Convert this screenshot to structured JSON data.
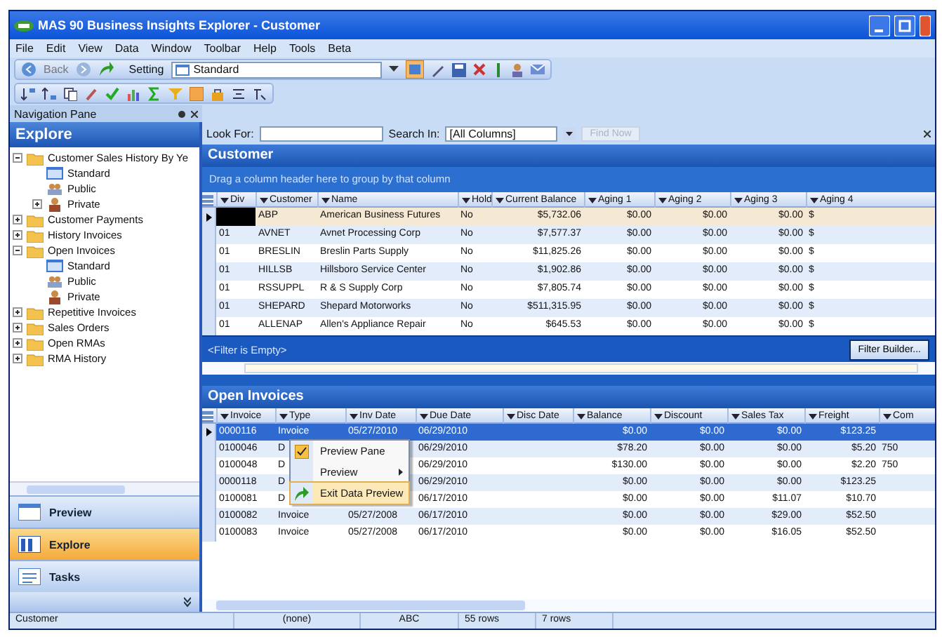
{
  "window": {
    "title": "MAS 90 Business Insights Explorer - Customer"
  },
  "menu_bar": [
    "File",
    "Edit",
    "View",
    "Data",
    "Window",
    "Toolbar",
    "Help",
    "Tools",
    "Beta"
  ],
  "toolbar": {
    "back_label": "Back",
    "setting_label": "Setting",
    "setting_value": "Standard"
  },
  "navigation_pane": {
    "title": "Navigation Pane",
    "header": "Explore",
    "tree": [
      {
        "label": "Customer Sales History By Ye",
        "kind": "folder",
        "expanded": true,
        "children": [
          {
            "label": "Standard",
            "kind": "standard"
          },
          {
            "label": "Public",
            "kind": "public"
          },
          {
            "label": "Private",
            "kind": "private",
            "expanded": false
          }
        ]
      },
      {
        "label": "Customer Payments",
        "kind": "folder",
        "expanded": false
      },
      {
        "label": "History Invoices",
        "kind": "folder",
        "expanded": false
      },
      {
        "label": "Open Invoices",
        "kind": "folder",
        "expanded": true,
        "children": [
          {
            "label": "Standard",
            "kind": "standard"
          },
          {
            "label": "Public",
            "kind": "public"
          },
          {
            "label": "Private",
            "kind": "private"
          }
        ]
      },
      {
        "label": "Repetitive Invoices",
        "kind": "folder",
        "expanded": false
      },
      {
        "label": "Sales Orders",
        "kind": "folder",
        "expanded": false
      },
      {
        "label": "Open RMAs",
        "kind": "folder",
        "expanded": false
      },
      {
        "label": "RMA History",
        "kind": "folder",
        "expanded": false
      }
    ],
    "buttons": [
      {
        "label": "Preview",
        "kind": "preview",
        "selected": false
      },
      {
        "label": "Explore",
        "kind": "explore",
        "selected": true
      },
      {
        "label": "Tasks",
        "kind": "tasks",
        "selected": false
      }
    ]
  },
  "search_bar": {
    "look_for_label": "Look For:",
    "search_in_label": "Search In:",
    "search_in_value": "[All Columns]",
    "find_button": {
      "label": "Find Now",
      "disabled": true
    }
  },
  "customer_grid": {
    "title": "Customer",
    "group_hint": "Drag a column header here to group by that column",
    "columns": [
      "Div",
      "Customer",
      "Name",
      "Hold",
      "Current Balance",
      "Aging 1",
      "Aging 2",
      "Aging 3",
      "Aging 4"
    ],
    "rows": [
      {
        "selected": true,
        "cells": [
          null,
          "ABP",
          "American Business Futures",
          "No",
          "$5,732.06",
          "$0.00",
          "$0.00",
          "$0.00",
          "$"
        ]
      },
      {
        "selected": false,
        "cells": [
          "01",
          "AVNET",
          "Avnet Processing Corp",
          "No",
          "$7,577.37",
          "$0.00",
          "$0.00",
          "$0.00",
          "$"
        ]
      },
      {
        "selected": false,
        "cells": [
          "01",
          "BRESLIN",
          "Breslin Parts Supply",
          "No",
          "$11,825.26",
          "$0.00",
          "$0.00",
          "$0.00",
          "$"
        ]
      },
      {
        "selected": false,
        "cells": [
          "01",
          "HILLSB",
          "Hillsboro Service Center",
          "No",
          "$1,902.86",
          "$0.00",
          "$0.00",
          "$0.00",
          "$"
        ]
      },
      {
        "selected": false,
        "cells": [
          "01",
          "RSSUPPL",
          "R & S Supply Corp",
          "No",
          "$7,805.74",
          "$0.00",
          "$0.00",
          "$0.00",
          "$"
        ]
      },
      {
        "selected": false,
        "cells": [
          "01",
          "SHEPARD",
          "Shepard Motorworks",
          "No",
          "$511,315.95",
          "$0.00",
          "$0.00",
          "$0.00",
          "$"
        ]
      },
      {
        "selected": false,
        "cells": [
          "01",
          "ALLENAP",
          "Allen's Appliance Repair",
          "No",
          "$645.53",
          "$0.00",
          "$0.00",
          "$0.00",
          "$"
        ]
      }
    ],
    "filter_text": "<Filter is Empty>",
    "filter_button": "Filter Builder..."
  },
  "invoice_grid": {
    "title": "Open Invoices",
    "columns": [
      "Invoice",
      "Type",
      "Inv Date",
      "Due Date",
      "Disc Date",
      "Balance",
      "Discount",
      "Sales Tax",
      "Freight",
      "Com"
    ],
    "rows": [
      {
        "selected": true,
        "cells": [
          "0000116",
          "Invoice",
          "05/27/2010",
          "06/29/2010",
          null,
          "$0.00",
          "$0.00",
          "$0.00",
          "$123.25",
          null
        ]
      },
      {
        "selected": false,
        "cells": [
          "0100046",
          "D",
          null,
          "06/29/2010",
          null,
          "$78.20",
          "$0.00",
          "$0.00",
          "$5.20",
          "750"
        ]
      },
      {
        "selected": false,
        "cells": [
          "0100048",
          "D",
          null,
          "06/29/2010",
          null,
          "$130.00",
          "$0.00",
          "$0.00",
          "$2.20",
          "750"
        ]
      },
      {
        "selected": false,
        "cells": [
          "0000118",
          "D",
          null,
          "06/29/2010",
          null,
          "$0.00",
          "$0.00",
          "$0.00",
          "$123.25",
          null
        ]
      },
      {
        "selected": false,
        "cells": [
          "0100081",
          "D",
          null,
          "06/17/2010",
          null,
          "$0.00",
          "$0.00",
          "$11.07",
          "$10.70",
          null
        ]
      },
      {
        "selected": false,
        "cells": [
          "0100082",
          "Invoice",
          "05/27/2008",
          "06/17/2010",
          null,
          "$0.00",
          "$0.00",
          "$29.00",
          "$52.50",
          null
        ]
      },
      {
        "selected": false,
        "cells": [
          "0100083",
          "Invoice",
          "05/27/2008",
          "06/17/2010",
          null,
          "$0.00",
          "$0.00",
          "$16.05",
          "$52.50",
          null
        ]
      }
    ]
  },
  "context_menu": [
    {
      "label": "Preview Pane",
      "kind": "check",
      "checked": true,
      "highlighted": false
    },
    {
      "label": "Preview",
      "kind": "submenu",
      "highlighted": false
    },
    {
      "label": "Exit Data Preview",
      "kind": "command",
      "highlighted": true
    }
  ],
  "status_bar": [
    "Customer",
    "(none)",
    "ABC",
    "55 rows",
    "7 rows"
  ]
}
